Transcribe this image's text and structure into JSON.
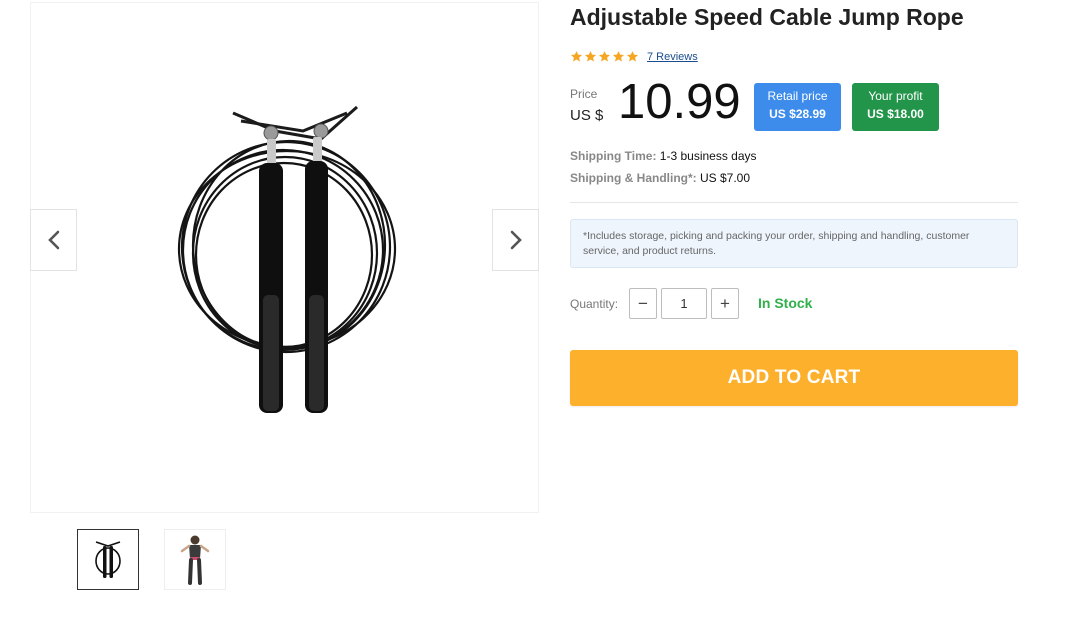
{
  "product": {
    "title": "Adjustable Speed Cable Jump Rope",
    "rating": 5,
    "rating_max": 5,
    "reviews_text": "7 Reviews"
  },
  "price": {
    "label": "Price",
    "currency": "US $",
    "value": "10.99"
  },
  "retail": {
    "label": "Retail price",
    "value": "US $28.99"
  },
  "profit": {
    "label": "Your profit",
    "value": "US $18.00"
  },
  "shipping": {
    "time_label": "Shipping Time:",
    "time_value": "1-3 business days",
    "handling_label": "Shipping & Handling*:",
    "handling_value": "US $7.00"
  },
  "note": "*Includes storage, picking and packing your order, shipping and handling, customer service, and product returns.",
  "quantity": {
    "label": "Quantity:",
    "value": "1",
    "minus": "−",
    "plus": "+"
  },
  "stock_status": "In Stock",
  "cart_button": "ADD TO CART",
  "gallery": {
    "icons": [
      "chevron-left-icon",
      "chevron-right-icon"
    ],
    "thumbnails": [
      "jump-rope",
      "person-jumping-rope"
    ]
  },
  "colors": {
    "star": "#f5a623",
    "retail_badge": "#3d8cec",
    "profit_badge": "#23954a",
    "in_stock": "#31b04b",
    "cart_button": "#fdb02b",
    "reviews_link": "#1a4d8f"
  }
}
